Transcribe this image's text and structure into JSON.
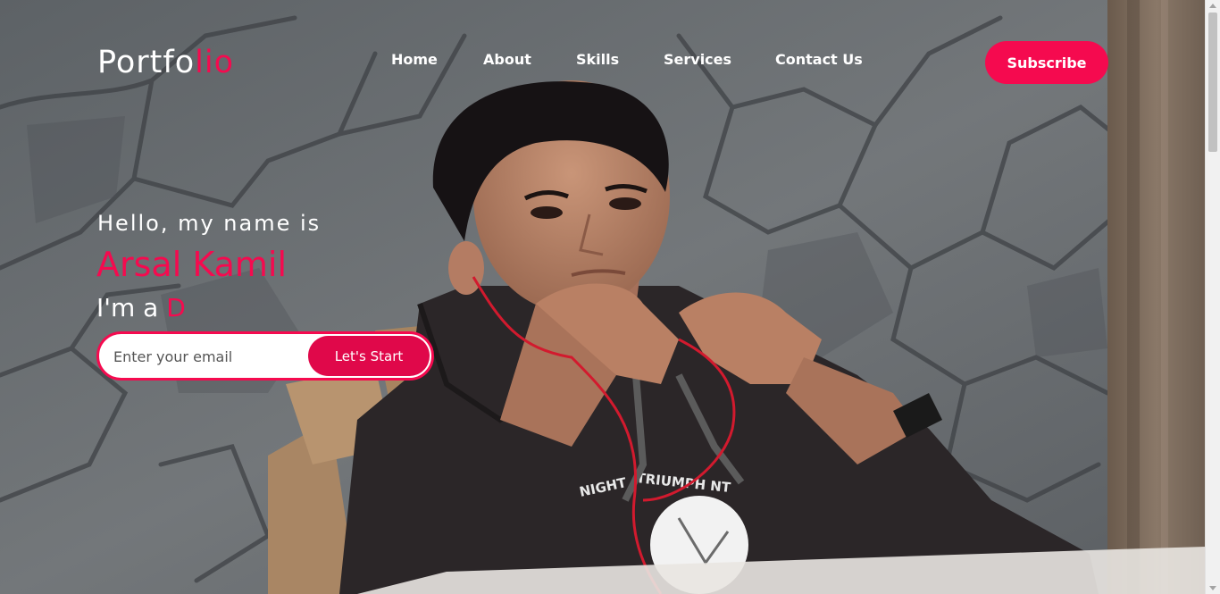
{
  "header": {
    "logo_part1": "Portfo",
    "logo_part2": "lio",
    "nav": [
      {
        "label": "Home"
      },
      {
        "label": "About"
      },
      {
        "label": "Skills"
      },
      {
        "label": "Services"
      },
      {
        "label": "Contact Us"
      }
    ],
    "subscribe_label": "Subscribe"
  },
  "hero": {
    "greeting": "Hello, my name is",
    "name": "Arsal Kamil",
    "role_prefix": "I'm a ",
    "role_typed": "D",
    "email_placeholder": "Enter your email",
    "cta_label": "Let's Start"
  },
  "background": {
    "shirt_text_left": "NIGHT",
    "shirt_text_right": "TRIUMPH NT"
  },
  "colors": {
    "accent": "#f50a4f",
    "text": "#ffffff"
  }
}
